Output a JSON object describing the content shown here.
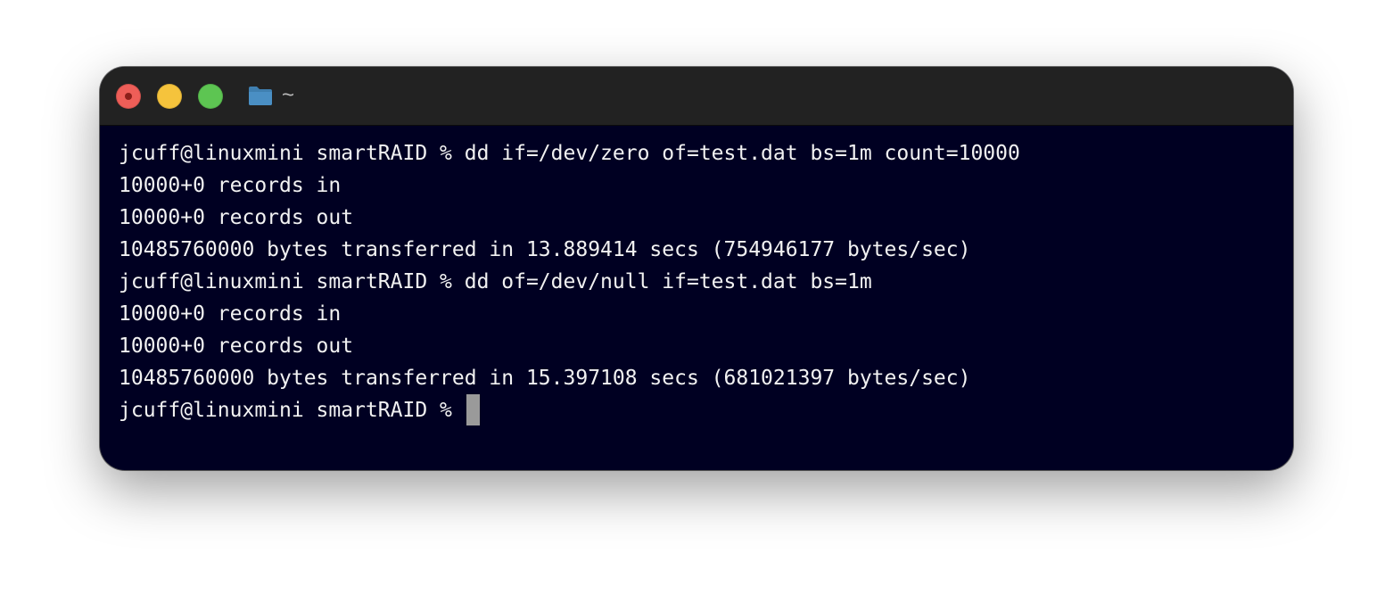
{
  "window": {
    "title": "~",
    "traffic_lights": {
      "close_color": "#ee5e58",
      "minimize_color": "#f5c33c",
      "zoom_color": "#5dc552"
    },
    "title_icon": "folder-icon"
  },
  "terminal": {
    "background": "#000022",
    "foreground": "#f2f2f2",
    "lines": [
      "jcuff@linuxmini smartRAID % dd if=/dev/zero of=test.dat bs=1m count=10000",
      "10000+0 records in",
      "10000+0 records out",
      "10485760000 bytes transferred in 13.889414 secs (754946177 bytes/sec)",
      "jcuff@linuxmini smartRAID % dd of=/dev/null if=test.dat bs=1m",
      "10000+0 records in",
      "10000+0 records out",
      "10485760000 bytes transferred in 15.397108 secs (681021397 bytes/sec)"
    ],
    "prompt": "jcuff@linuxmini smartRAID % "
  }
}
